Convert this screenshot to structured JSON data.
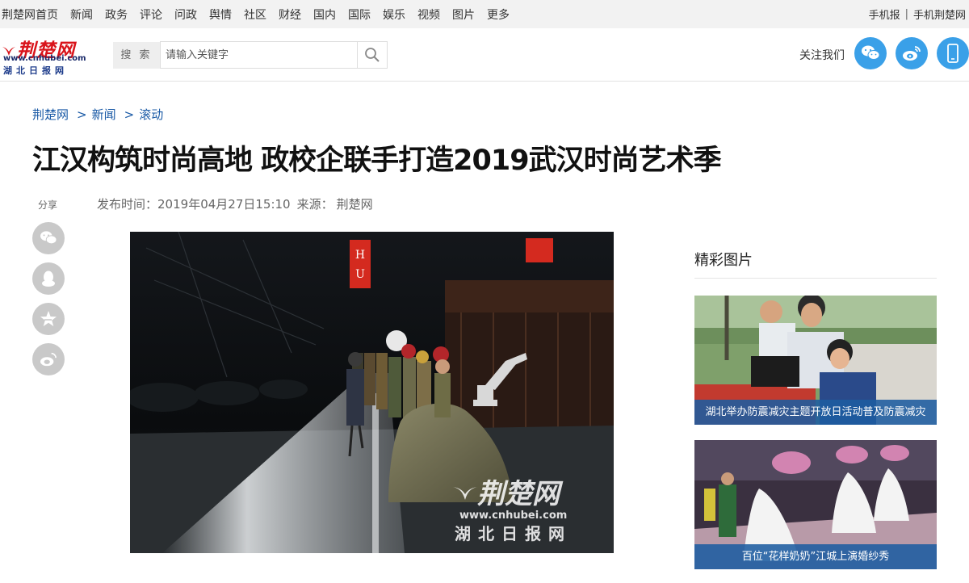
{
  "topnav": {
    "items": [
      "荆楚网首页",
      "新闻",
      "政务",
      "评论",
      "问政",
      "舆情",
      "社区",
      "财经",
      "国内",
      "国际",
      "娱乐",
      "视频",
      "图片",
      "更多"
    ],
    "right_links": [
      "手机报",
      "手机荆楚网"
    ],
    "right_separator": "|"
  },
  "logo": {
    "name": "荆楚网",
    "url_text": "www.cnhubei.com",
    "subtitle": "湖北日报网"
  },
  "search": {
    "label": "搜 索",
    "placeholder": "请输入关键字",
    "icon": "search-icon"
  },
  "follow": {
    "label": "关注我们",
    "icons": [
      "wechat-icon",
      "weibo-icon",
      "mobile-icon"
    ],
    "color": "#3aa0e8"
  },
  "breadcrumb": {
    "items": [
      "荆楚网",
      "新闻",
      "滚动"
    ],
    "separator": ">",
    "color": "#1a5aa6"
  },
  "article": {
    "title": "江汉构筑时尚高地 政校企联手打造2019武汉时尚艺术季",
    "publish_label": "发布时间：",
    "publish_time": "2019年04月27日15:10",
    "source_label": "来源：",
    "source": "荆楚网",
    "image_watermark_main": "荆楚网",
    "image_watermark_url": "www.cnhubei.com",
    "image_watermark_sub": "湖北日报网"
  },
  "share": {
    "label": "分享",
    "icons": [
      "wechat-icon",
      "qq-icon",
      "qzone-star-icon",
      "weibo-icon"
    ]
  },
  "sidebar": {
    "title": "精彩图片",
    "pictures": [
      {
        "caption": "湖北举办防震减灾主题开放日活动普及防震减灾"
      },
      {
        "caption": "百位“花样奶奶”江城上演婚纱秀"
      }
    ]
  }
}
